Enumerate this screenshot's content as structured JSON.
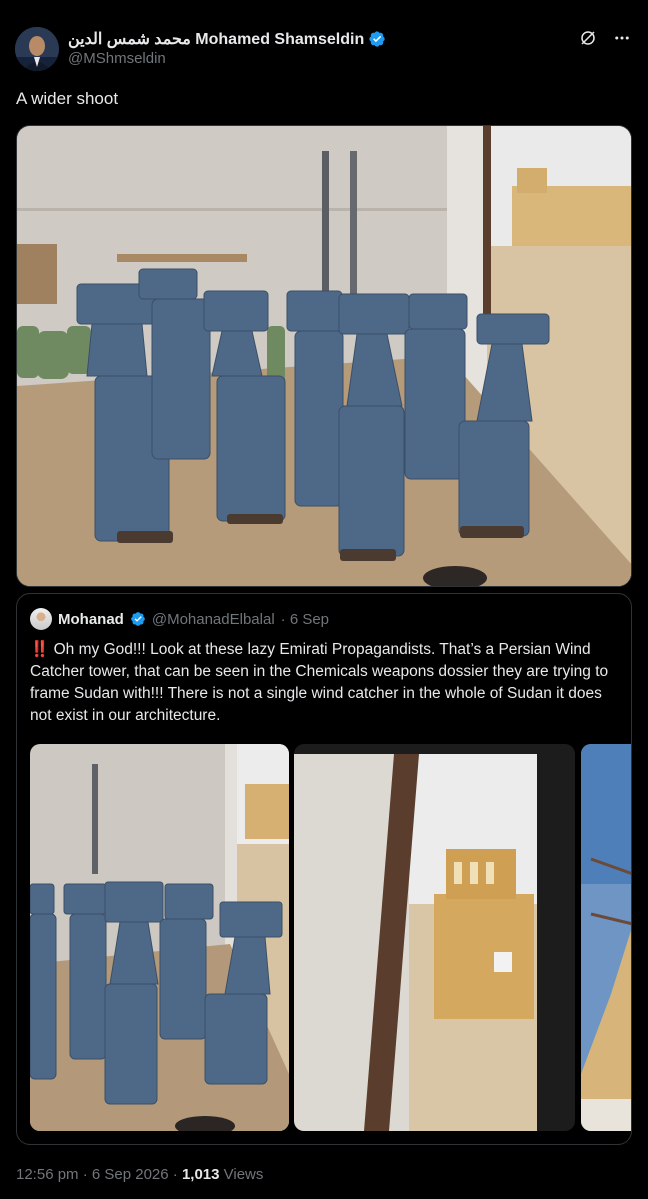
{
  "author": {
    "name": "محمد شمس الدين Mohamed Shamseldin",
    "handle": "@MShmseldin"
  },
  "tweet": {
    "text": "A wider shoot"
  },
  "quote": {
    "name": "Mohanad",
    "handle": "@MohanadElbalal",
    "date": "· 6 Sep",
    "text_icon": "‼️",
    "text": "Oh my God!!! Look at these lazy Emirati Propagandists. That’s a Persian Wind Catcher tower, that can be seen in the Chemicals weapons dossier they are trying to frame Sudan with!!! There is not a single wind catcher in the whole of Sudan it does not exist in our architecture."
  },
  "meta": {
    "timestamp": "12:56 pm · 6 Sep 2026 · ",
    "views_count": "1,013",
    "views_label": " Views"
  },
  "icons": {
    "verified": "verified-badge-icon",
    "grok": "grok-icon",
    "more": "more-icon"
  },
  "colors": {
    "verified": "#1d9bf0",
    "background": "#000000",
    "secondary_text": "#71767b"
  }
}
